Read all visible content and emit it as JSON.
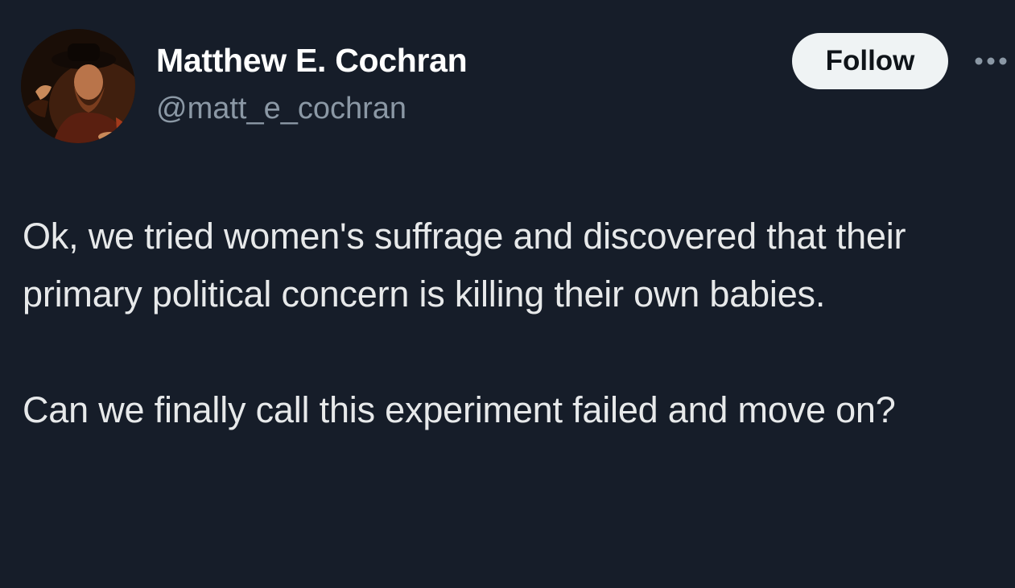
{
  "author": {
    "display_name": "Matthew E. Cochran",
    "handle": "@matt_e_cochran",
    "avatar_icon": "profile-painting-avatar"
  },
  "actions": {
    "follow_label": "Follow",
    "more_icon": "more-horizontal-icon"
  },
  "tweet": {
    "paragraphs": [
      "Ok, we tried women's suffrage and discovered that their primary political concern is killing their own babies.",
      "Can we finally call this experiment failed and move on?"
    ]
  },
  "colors": {
    "background": "#161d29",
    "text": "#e7e9ea",
    "secondary_text": "#8b98a5",
    "follow_button_bg": "#eff3f4",
    "follow_button_text": "#0f1419"
  }
}
